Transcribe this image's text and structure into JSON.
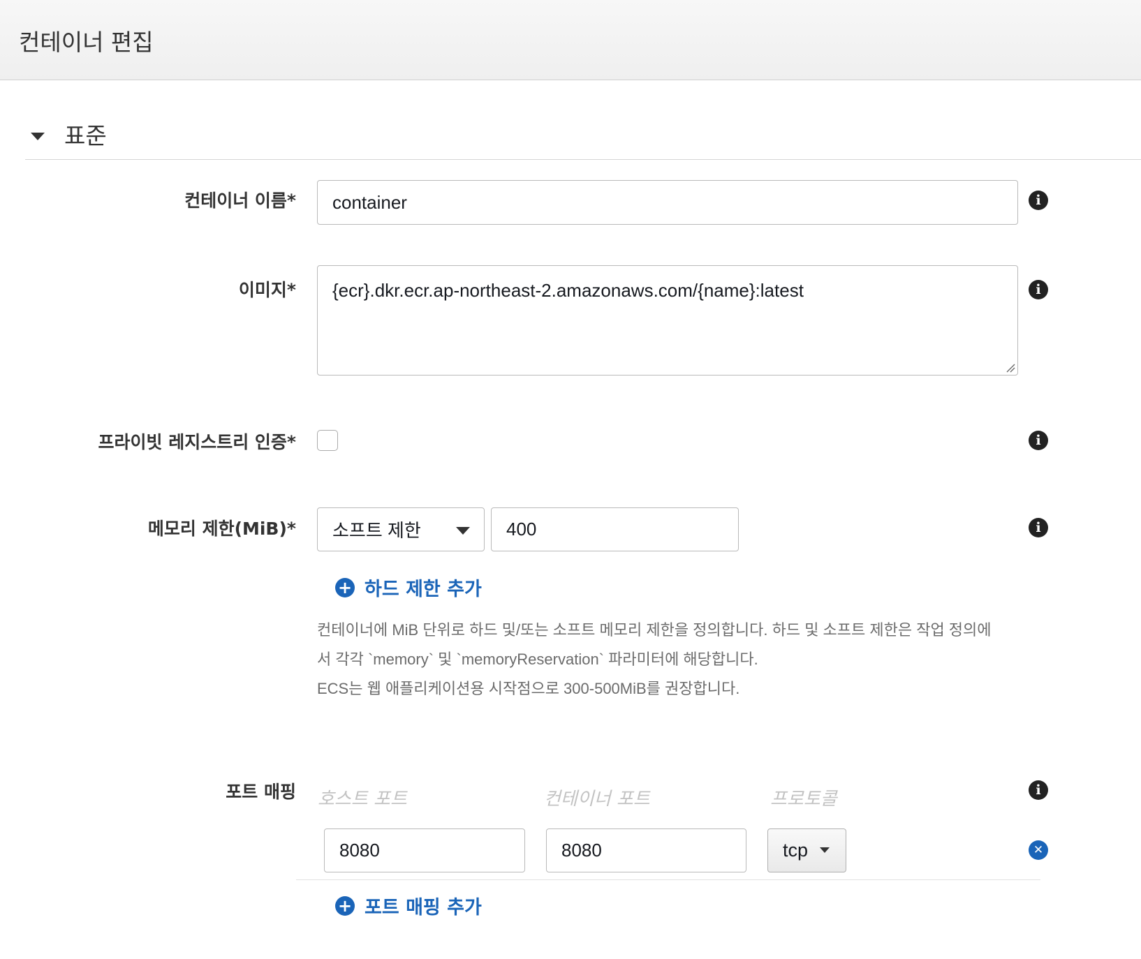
{
  "header": {
    "title": "컨테이너 편집"
  },
  "section": {
    "title": "표준"
  },
  "fields": {
    "container_name": {
      "label": "컨테이너 이름*",
      "value": "container"
    },
    "image": {
      "label": "이미지*",
      "value": "{ecr}.dkr.ecr.ap-northeast-2.amazonaws.com/{name}:latest"
    },
    "private_registry": {
      "label": "프라이빗 레지스트리 인증*",
      "checked": false
    },
    "memory": {
      "label": "메모리 제한(MiB)*",
      "limit_type": "소프트 제한",
      "value": "400",
      "add_hard_limit": "하드 제한 추가",
      "help_line1": "컨테이너에 MiB 단위로 하드 및/또는 소프트 메모리 제한을 정의합니다. 하드 및 소프트 제한은 작업 정의에",
      "help_line2": "서 각각 `memory` 및 `memoryReservation` 파라미터에 해당합니다.",
      "help_line3": "ECS는 웹 애플리케이션용 시작점으로 300-500MiB를 권장합니다."
    },
    "port_mapping": {
      "label": "포트 매핑",
      "col_host": "호스트 포트",
      "col_container": "컨테이너 포트",
      "col_protocol": "프로토콜",
      "host_port": "8080",
      "container_port": "8080",
      "protocol": "tcp",
      "add_label": "포트 매핑 추가"
    }
  },
  "icons": {
    "info": "info-icon",
    "plus": "plus-circle-icon",
    "remove": "x-circle-icon",
    "caret": "caret-down-icon"
  },
  "colors": {
    "link": "#1a64b8",
    "header_bg": "#f2f2f2"
  }
}
